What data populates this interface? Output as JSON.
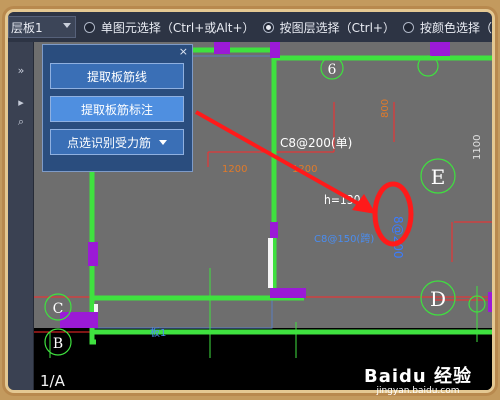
{
  "toolbar": {
    "floor": "层板1",
    "options": [
      {
        "label": "单图元选择（Ctrl+或Alt+）",
        "checked": false
      },
      {
        "label": "按图层选择（Ctrl+）",
        "checked": true
      },
      {
        "label": "按颜色选择（",
        "checked": false
      }
    ]
  },
  "left_strip": {
    "items": [
      "»",
      "▸",
      "⌕"
    ]
  },
  "panel": {
    "close": "×",
    "buttons": [
      {
        "label": "提取板筋线"
      },
      {
        "label": "提取板筋标注"
      },
      {
        "label": "点选识别受力筋"
      }
    ]
  },
  "drawing": {
    "axis_top": "6",
    "axis_right_1": "E",
    "axis_right_2": "D",
    "axis_left_1": "C",
    "axis_left_2": "B",
    "rebar_label": "C8@200(单)",
    "thickness": "h=130",
    "dim_1200_a": "1200",
    "dim_1200_b": "1200",
    "dim_1100": "1100",
    "dim_small_a": "800",
    "note_blue": "C8@150(跨)",
    "label_blue_2": "板1",
    "highlight_text": "8@200"
  },
  "status": {
    "layout": "1/A"
  },
  "watermark": {
    "logo": "Baidu 经验",
    "url": "jingyan.baidu.com"
  },
  "colors": {
    "wall_green": "#3fe13f",
    "purple": "#9b1ad6",
    "red_line": "#ff2a2a",
    "highlight_red": "#ff1a1a",
    "panel_blue": "#2a4d7e"
  }
}
